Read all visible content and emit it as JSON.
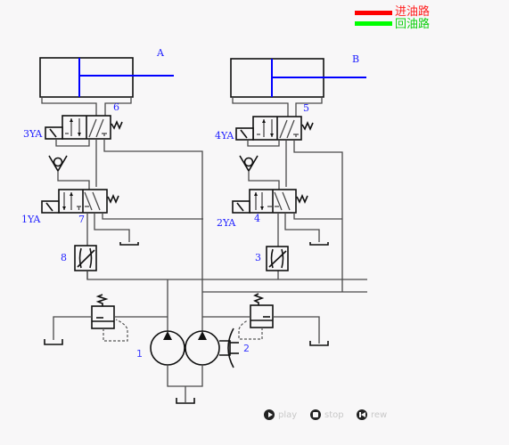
{
  "legend": {
    "items": [
      {
        "label": "进油路",
        "color": "#ff0000"
      },
      {
        "label": "回油路",
        "color": "#00ff00"
      }
    ]
  },
  "cylinders": [
    {
      "label": "A"
    },
    {
      "label": "B"
    }
  ],
  "valves": {
    "left_upper": {
      "number": "6",
      "solenoid": "3YA"
    },
    "left_lower": {
      "number": "7",
      "solenoid": "1YA"
    },
    "right_upper": {
      "number": "5",
      "solenoid": "4YA"
    },
    "right_lower": {
      "number": "4",
      "solenoid": "2YA"
    }
  },
  "throttles": [
    {
      "number": "8"
    },
    {
      "number": "3"
    }
  ],
  "pumps": {
    "number_left": "1",
    "number_right": "2"
  },
  "controls": {
    "play_label": "play",
    "stop_label": "stop",
    "rew_label": "rew"
  }
}
